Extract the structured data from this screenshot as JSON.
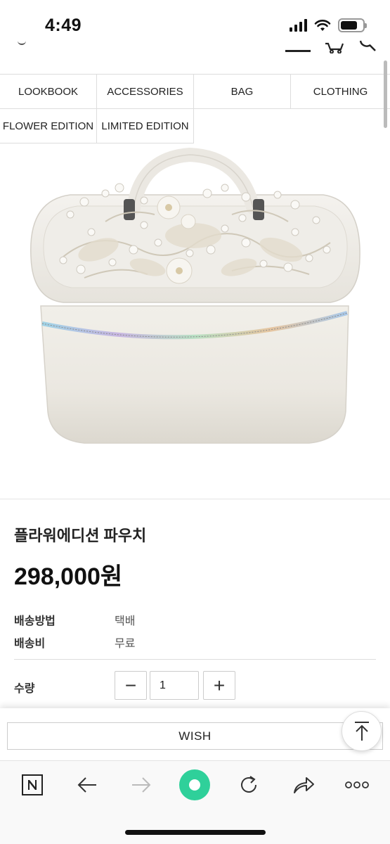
{
  "status_bar": {
    "time": "4:49",
    "icons": [
      "signal-icon",
      "wifi-icon",
      "battery-icon"
    ]
  },
  "header": {
    "icons": [
      "logo-icon",
      "menu-icon",
      "cart-icon",
      "search-icon"
    ]
  },
  "categories": {
    "row1": [
      "LOOKBOOK",
      "ACCESSORIES",
      "BAG",
      "CLOTHING"
    ],
    "row2": [
      "FLOWER EDITION",
      "LIMITED EDITION"
    ]
  },
  "product": {
    "image_desc_icon": "vanity-pouch-image",
    "name": "플라워에디션 파우치",
    "price": "298,000원",
    "shipping_method_label": "배송방법",
    "shipping_method_value": "택배",
    "shipping_fee_label": "배송비",
    "shipping_fee_value": "무료",
    "quantity_label": "수량",
    "quantity_value": "1",
    "minus_symbol": "−",
    "plus_symbol": "+"
  },
  "actions": {
    "wish_label": "WISH"
  },
  "browser_toolbar": {
    "items": [
      "naver-n-icon",
      "back-arrow-icon",
      "forward-arrow-icon",
      "home-green-icon",
      "reload-icon",
      "share-icon",
      "more-icon"
    ]
  },
  "colors": {
    "accent_green": "#2fd09a",
    "border": "#dddddd",
    "text": "#222222"
  }
}
